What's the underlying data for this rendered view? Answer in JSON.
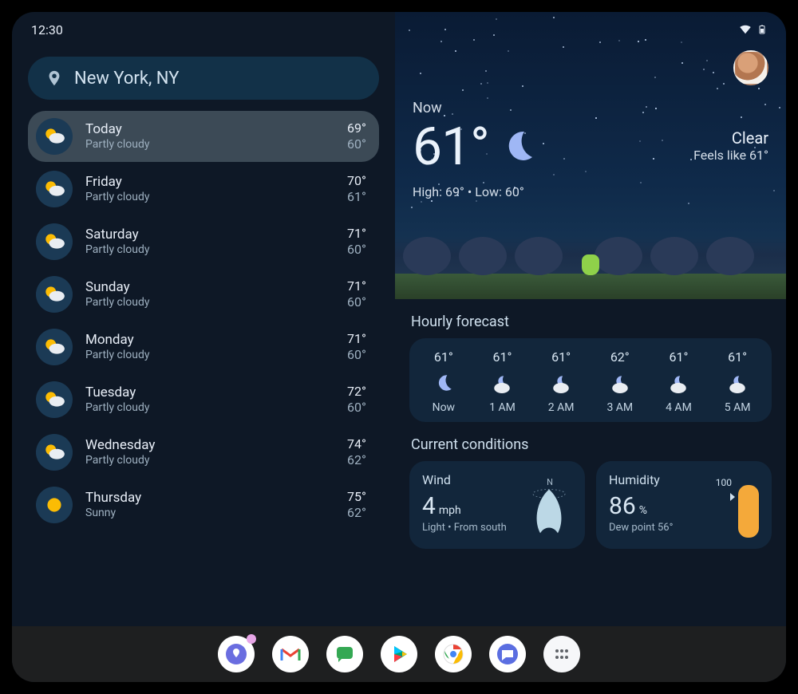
{
  "statusbar": {
    "time": "12:30"
  },
  "location": {
    "name": "New York, NY"
  },
  "days": [
    {
      "name": "Today",
      "condition": "Partly cloudy",
      "hi": "69°",
      "lo": "60°",
      "icon": "partly-cloudy",
      "selected": true
    },
    {
      "name": "Friday",
      "condition": "Partly cloudy",
      "hi": "70°",
      "lo": "61°",
      "icon": "partly-cloudy",
      "selected": false
    },
    {
      "name": "Saturday",
      "condition": "Partly cloudy",
      "hi": "71°",
      "lo": "60°",
      "icon": "partly-cloudy",
      "selected": false
    },
    {
      "name": "Sunday",
      "condition": "Partly cloudy",
      "hi": "71°",
      "lo": "60°",
      "icon": "partly-cloudy",
      "selected": false
    },
    {
      "name": "Monday",
      "condition": "Partly cloudy",
      "hi": "71°",
      "lo": "60°",
      "icon": "partly-cloudy",
      "selected": false
    },
    {
      "name": "Tuesday",
      "condition": "Partly cloudy",
      "hi": "72°",
      "lo": "60°",
      "icon": "partly-cloudy",
      "selected": false
    },
    {
      "name": "Wednesday",
      "condition": "Partly cloudy",
      "hi": "74°",
      "lo": "62°",
      "icon": "partly-cloudy",
      "selected": false
    },
    {
      "name": "Thursday",
      "condition": "Sunny",
      "hi": "75°",
      "lo": "62°",
      "icon": "sunny",
      "selected": false
    }
  ],
  "hero": {
    "now_label": "Now",
    "temp": "61°",
    "condition": "Clear",
    "feels": "Feels like 61°",
    "hilo": "High: 69° • Low: 60°",
    "icon": "moon"
  },
  "hourly": {
    "title": "Hourly forecast",
    "items": [
      {
        "temp": "61°",
        "label": "Now",
        "icon": "moon"
      },
      {
        "temp": "61°",
        "label": "1 AM",
        "icon": "cloudy-night"
      },
      {
        "temp": "61°",
        "label": "2 AM",
        "icon": "cloudy-night"
      },
      {
        "temp": "62°",
        "label": "3 AM",
        "icon": "cloudy-night"
      },
      {
        "temp": "61°",
        "label": "4 AM",
        "icon": "cloudy-night"
      },
      {
        "temp": "61°",
        "label": "5 AM",
        "icon": "cloudy-night"
      }
    ]
  },
  "conditions": {
    "title": "Current conditions",
    "wind": {
      "title": "Wind",
      "value": "4",
      "unit": "mph",
      "subtitle": "Light • From south",
      "dir_label": "N"
    },
    "humidity": {
      "title": "Humidity",
      "value": "86",
      "unit": "%",
      "subtitle": "Dew point 56°",
      "max_label": "100"
    }
  },
  "dock": {
    "apps": [
      {
        "name": "location-app",
        "color": "#6a6de0"
      },
      {
        "name": "gmail",
        "color": "#ea4335"
      },
      {
        "name": "chat",
        "color": "#34a853"
      },
      {
        "name": "play-store",
        "color": "#00a273"
      },
      {
        "name": "chrome",
        "color": "#4285f4"
      },
      {
        "name": "messages",
        "color": "#5b6ee1"
      },
      {
        "name": "app-drawer",
        "color": "#5f6368"
      }
    ]
  }
}
